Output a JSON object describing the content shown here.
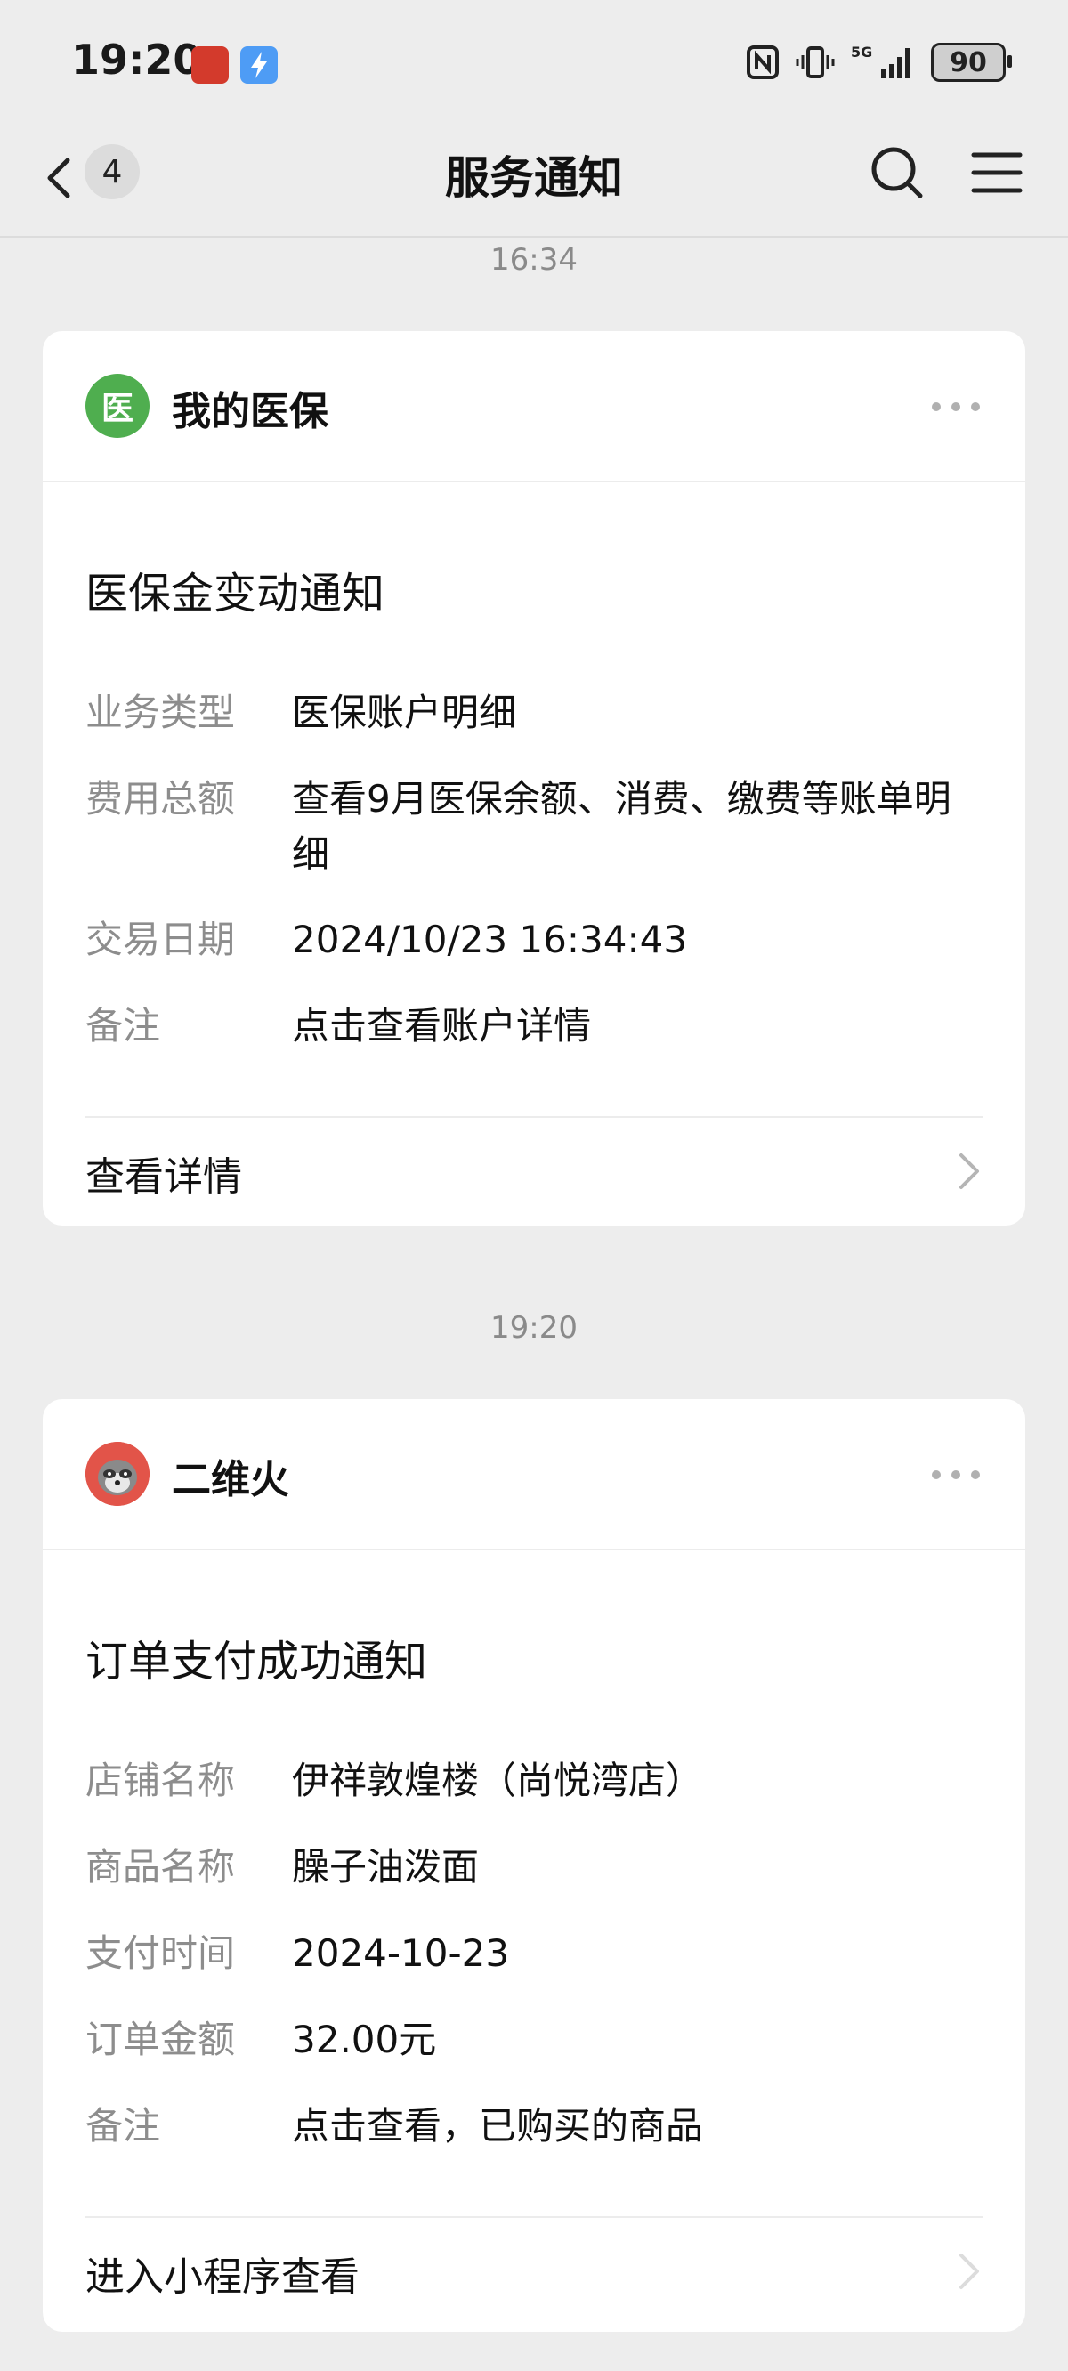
{
  "status_bar": {
    "time": "19:20",
    "battery": "90",
    "network": "5G"
  },
  "nav": {
    "unread_count": "4",
    "title": "服务通知"
  },
  "timestamps": [
    "16:34",
    "19:20"
  ],
  "cards": [
    {
      "sender": "我的医保",
      "avatar_text": "医",
      "title": "医保金变动通知",
      "rows": [
        {
          "label": "业务类型",
          "value": "医保账户明细"
        },
        {
          "label": "费用总额",
          "value": "查看9月医保余额、消费、缴费等账单明细"
        },
        {
          "label": "交易日期",
          "value": "2024/10/23 16:34:43"
        },
        {
          "label": "备注",
          "value": "点击查看账户详情"
        }
      ],
      "footer": "查看详情"
    },
    {
      "sender": "二维火",
      "title": "订单支付成功通知",
      "rows": [
        {
          "label": "店铺名称",
          "value": "伊祥敦煌楼（尚悦湾店）"
        },
        {
          "label": "商品名称",
          "value": "臊子油泼面"
        },
        {
          "label": "支付时间",
          "value": "2024-10-23"
        },
        {
          "label": "订单金额",
          "value": "32.00元"
        },
        {
          "label": "备注",
          "value": "点击查看，已购买的商品"
        }
      ],
      "footer": "进入小程序查看"
    }
  ],
  "colors": {
    "background": "#ededed",
    "card": "#ffffff",
    "label_gray": "#8d8d8d",
    "medical_green": "#4fae4f"
  }
}
